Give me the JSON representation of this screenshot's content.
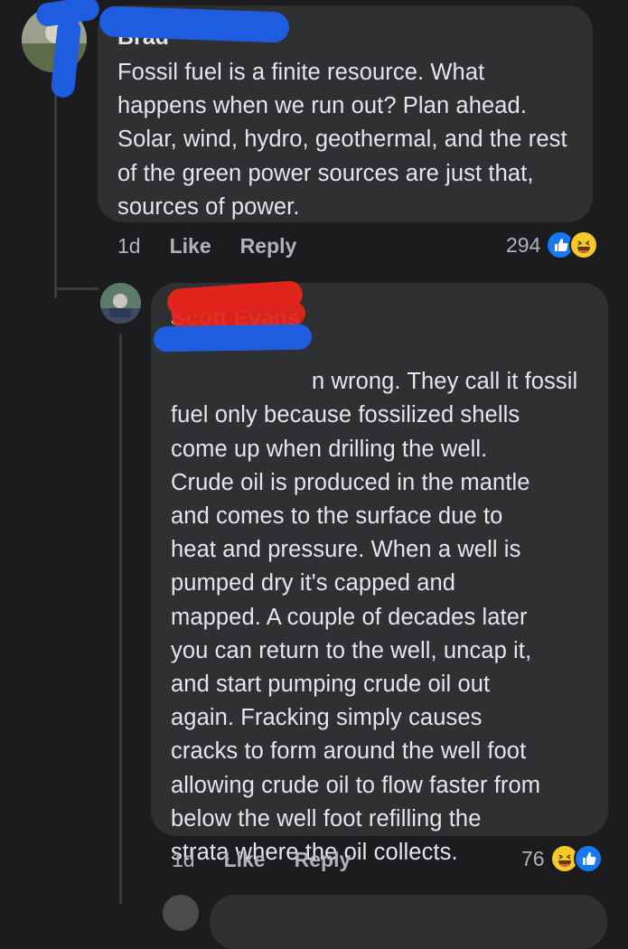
{
  "comments": [
    {
      "author": "Brad",
      "text": "Fossil fuel is a finite resource.  What happens when we run out?  Plan ahead.  Solar, wind, hydro, geothermal, and the rest of the green power sources are just that, sources of power.",
      "time": "1d",
      "like_label": "Like",
      "reply_label": "Reply",
      "reaction_count": "294",
      "reaction_icons": [
        "like-icon",
        "haha-icon"
      ]
    },
    {
      "author": "Scott Evans",
      "text": "n wrong. They call it fossil\nfuel only because fossilized shells\ncome up when drilling the well.\nCrude oil is produced in the mantle\nand comes to the surface due to\nheat and pressure. When a well is\npumped dry it's capped and\nmapped. A couple of decades later\nyou can return to the well, uncap it,\nand start pumping crude oil out\nagain. Fracking simply causes\ncracks to form around the well foot\nallowing crude oil to flow faster from\nbelow the well foot refilling the\nstrata where the oil collects.",
      "time": "1d",
      "like_label": "Like",
      "reply_label": "Reply",
      "reaction_count": "76",
      "reaction_icons": [
        "haha-icon",
        "like-icon"
      ]
    }
  ],
  "colors": {
    "background": "#1c1c1e",
    "bubble": "#2f3032",
    "text": "#e4e6eb",
    "meta": "#b0b3b8",
    "like": "#1877f2",
    "haha": "#f7c928",
    "redact_blue": "#1f5de0",
    "redact_red": "#e0241b"
  }
}
